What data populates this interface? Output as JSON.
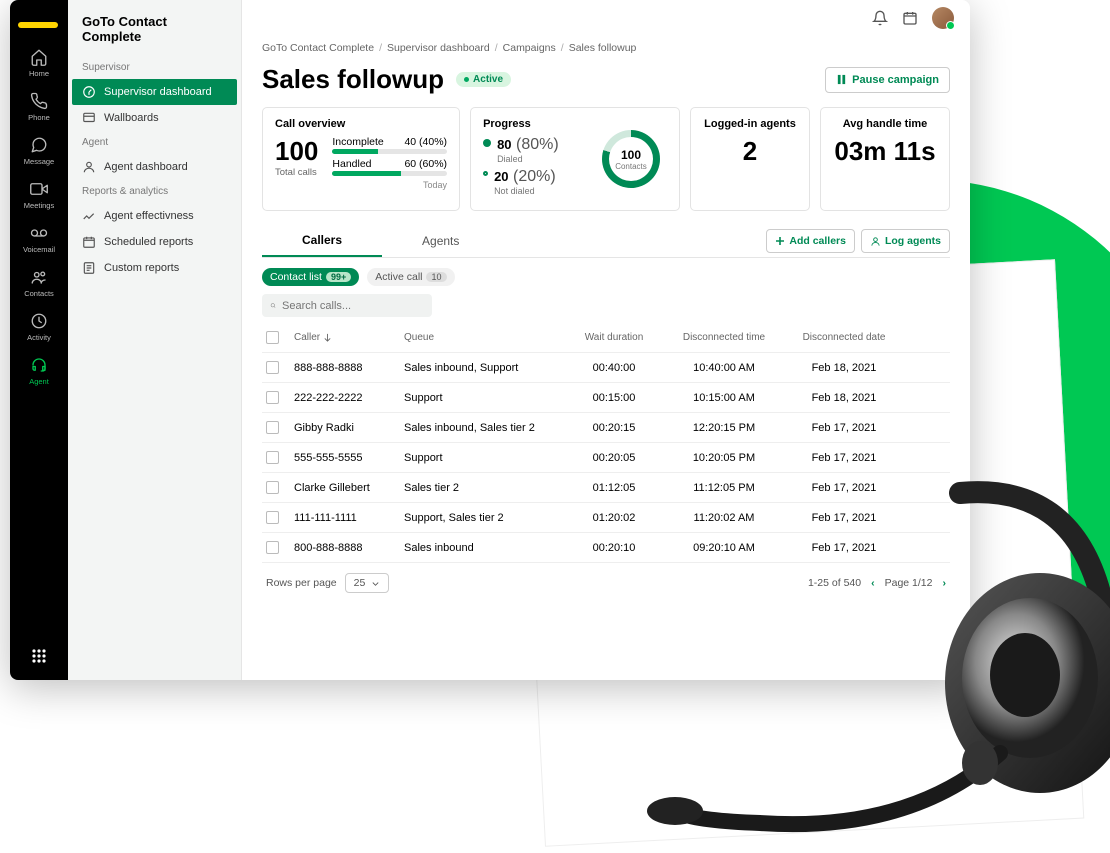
{
  "rail": [
    {
      "id": "home",
      "label": "Home"
    },
    {
      "id": "phone",
      "label": "Phone"
    },
    {
      "id": "message",
      "label": "Message"
    },
    {
      "id": "meetings",
      "label": "Meetings"
    },
    {
      "id": "voicemail",
      "label": "Voicemail"
    },
    {
      "id": "contacts",
      "label": "Contacts"
    },
    {
      "id": "activity",
      "label": "Activity"
    },
    {
      "id": "agent",
      "label": "Agent"
    }
  ],
  "sidebar": {
    "title": "GoTo Contact Complete",
    "groups": [
      {
        "label": "Supervisor",
        "items": [
          {
            "id": "sup-dash",
            "label": "Supervisor dashboard",
            "active": true
          },
          {
            "id": "wallboards",
            "label": "Wallboards"
          }
        ]
      },
      {
        "label": "Agent",
        "items": [
          {
            "id": "agent-dash",
            "label": "Agent dashboard"
          }
        ]
      },
      {
        "label": "Reports & analytics",
        "items": [
          {
            "id": "agent-eff",
            "label": "Agent effectivness"
          },
          {
            "id": "sched",
            "label": "Scheduled reports"
          },
          {
            "id": "custom",
            "label": "Custom reports"
          }
        ]
      }
    ]
  },
  "breadcrumbs": [
    "GoTo Contact Complete",
    "Supervisor dashboard",
    "Campaigns",
    "Sales followup"
  ],
  "page": {
    "title": "Sales followup",
    "status": "Active",
    "pause": "Pause campaign"
  },
  "overview": {
    "title": "Call overview",
    "total": "100",
    "total_label": "Total calls",
    "rows": [
      {
        "label": "Incomplete",
        "value": "40 (40%)",
        "pct": 40
      },
      {
        "label": "Handled",
        "value": "60 (60%)",
        "pct": 60
      }
    ],
    "today": "Today"
  },
  "progress": {
    "title": "Progress",
    "items": [
      {
        "value": "80",
        "pct": "(80%)",
        "label": "Dialed"
      },
      {
        "value": "20",
        "pct": "(20%)",
        "label": "Not dialed"
      }
    ],
    "ring": {
      "value": "100",
      "label": "Contacts"
    }
  },
  "agents": {
    "title": "Logged-in agents",
    "value": "2"
  },
  "handle": {
    "title": "Avg handle time",
    "value": "03m 11s"
  },
  "tabs": {
    "callers": "Callers",
    "agents": "Agents",
    "add": "Add callers",
    "log": "Log agents"
  },
  "chips": {
    "contact": "Contact list",
    "contact_count": "99+",
    "active": "Active call",
    "active_count": "10"
  },
  "search": {
    "placeholder": "Search calls..."
  },
  "columns": {
    "caller": "Caller",
    "queue": "Queue",
    "wait": "Wait duration",
    "dtime": "Disconnected time",
    "ddate": "Disconnected date"
  },
  "rows": [
    {
      "caller": "888-888-8888",
      "queue": "Sales inbound, Support",
      "wait": "00:40:00",
      "dtime": "10:40:00 AM",
      "ddate": "Feb 18, 2021"
    },
    {
      "caller": "222-222-2222",
      "queue": "Support",
      "wait": "00:15:00",
      "dtime": "10:15:00 AM",
      "ddate": "Feb 18, 2021"
    },
    {
      "caller": "Gibby Radki",
      "queue": "Sales inbound, Sales tier 2",
      "wait": "00:20:15",
      "dtime": "12:20:15 PM",
      "ddate": "Feb 17, 2021"
    },
    {
      "caller": "555-555-5555",
      "queue": "Support",
      "wait": "00:20:05",
      "dtime": "10:20:05 PM",
      "ddate": "Feb 17, 2021"
    },
    {
      "caller": "Clarke Gillebert",
      "queue": "Sales tier 2",
      "wait": "01:12:05",
      "dtime": "11:12:05 PM",
      "ddate": "Feb 17, 2021"
    },
    {
      "caller": "111-111-1111",
      "queue": "Support, Sales tier 2",
      "wait": "01:20:02",
      "dtime": "11:20:02 AM",
      "ddate": "Feb 17, 2021"
    },
    {
      "caller": "800-888-8888",
      "queue": "Sales inbound",
      "wait": "00:20:10",
      "dtime": "09:20:10 AM",
      "ddate": "Feb 17, 2021"
    }
  ],
  "pager": {
    "rpp": "Rows per page",
    "rpp_val": "25",
    "range": "1-25 of 540",
    "page": "Page 1/12"
  }
}
